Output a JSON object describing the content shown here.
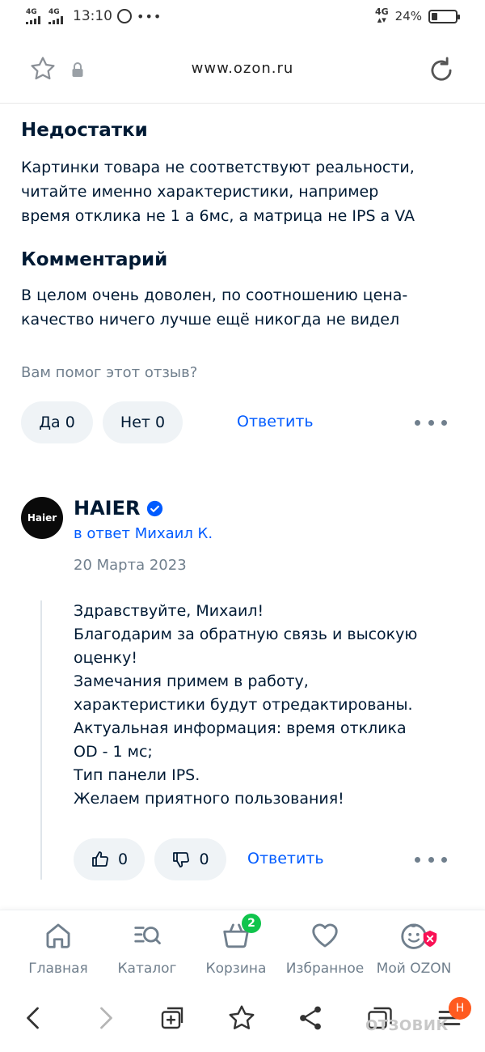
{
  "status_bar": {
    "sim1": "4G",
    "sim2": "4G",
    "time": "13:10",
    "network": "4G",
    "battery_percent": "24%",
    "battery_level": 0.24
  },
  "browser": {
    "url": "www.ozon.ru"
  },
  "review": {
    "cons_heading": "Недостатки",
    "cons_lines": [
      "Картинки товара не соответствуют реальности,",
      "читайте именно характеристики, например",
      "время отклика не 1 а 6мс, а матрица не IPS а VA"
    ],
    "comment_heading": "Комментарий",
    "comment_lines": [
      "В целом очень доволен, по соотношению цена-",
      "качество ничего лучше ещё никогда не видел"
    ],
    "helpful_question": "Вам помог этот отзыв?",
    "yes_label": "Да 0",
    "no_label": "Нет 0",
    "reply_label": "Ответить"
  },
  "seller_reply": {
    "avatar_text": "Haier",
    "name": "HAIER",
    "in_reply_to": "в ответ Михаил К.",
    "date": "20 Марта 2023",
    "text_lines": [
      "Здравствуйте, Михаил!",
      "Благодарим за обратную связь и высокую",
      "оценку!",
      "Замечания примем в работу,",
      "характеристики будут отредактированы.",
      "Актуальная информация: время отклика",
      "OD - 1 мс;",
      "Тип панели IPS.",
      "Желаем приятного пользования!"
    ],
    "likes": "0",
    "dislikes": "0",
    "reply_label": "Ответить"
  },
  "tab_bar": {
    "items": [
      {
        "label": "Главная",
        "icon": "home-icon"
      },
      {
        "label": "Каталог",
        "icon": "catalog-search-icon"
      },
      {
        "label": "Корзина",
        "icon": "cart-icon",
        "badge": "2"
      },
      {
        "label": "Избранное",
        "icon": "heart-icon"
      },
      {
        "label": "Мой OZON",
        "icon": "profile-icon"
      }
    ]
  },
  "nav_bar": {
    "profile_letter": "H",
    "watermark": "ОТЗОВИК"
  },
  "colors": {
    "text": "#001a34",
    "link": "#005bff",
    "muted": "#707f8d",
    "pill_bg": "#eff3f6",
    "badge_green": "#10c44c",
    "badge_red": "#f91155"
  }
}
